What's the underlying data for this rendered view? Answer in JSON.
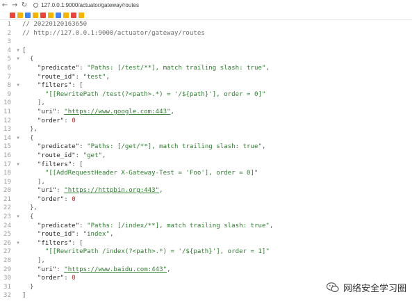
{
  "browser": {
    "url": "127.0.0.1:9000/actuator/gateway/routes",
    "back_icon": "back-arrow-icon",
    "forward_icon": "forward-arrow-icon",
    "reload_icon": "reload-icon"
  },
  "bookmarks": [
    {
      "icon": "bookmark-icon-1",
      "color": "#e8453c"
    },
    {
      "icon": "bookmark-icon-2",
      "color": "#f4b400"
    },
    {
      "icon": "bookmark-icon-3",
      "color": "#4285f4"
    },
    {
      "icon": "bookmark-icon-4",
      "color": "#f4b400"
    },
    {
      "icon": "bookmark-icon-5",
      "color": "#e8453c"
    },
    {
      "icon": "bookmark-icon-6",
      "color": "#f4b400"
    },
    {
      "icon": "bookmark-icon-7",
      "color": "#4285f4"
    },
    {
      "icon": "bookmark-icon-8",
      "color": "#f4b400"
    },
    {
      "icon": "bookmark-icon-9",
      "color": "#e8453c"
    },
    {
      "icon": "bookmark-icon-10",
      "color": "#f4b400"
    }
  ],
  "code": {
    "line_numbers": [
      "1",
      "2",
      "3",
      "4",
      "5",
      "6",
      "7",
      "8",
      "9",
      "10",
      "11",
      "12",
      "13",
      "14",
      "15",
      "16",
      "17",
      "18",
      "19",
      "20",
      "21",
      "22",
      "23",
      "24",
      "25",
      "26",
      "27",
      "28",
      "29",
      "30",
      "31",
      "32"
    ],
    "comment_1": "// 20220120163650",
    "comment_2": "// http://127.0.0.1:9000/actuator/gateway/routes",
    "routes": [
      {
        "predicate_key": "\"predicate\"",
        "predicate": "\"Paths: [/test/**], match trailing slash: true\"",
        "route_id_key": "\"route_id\"",
        "route_id": "\"test\"",
        "filters_key": "\"filters\"",
        "filter": "\"[[RewritePath /test(?<path>.*) = '/${path}'], order = 0]\"",
        "uri_key": "\"uri\"",
        "uri": "\"https://www.google.com:443\"",
        "order_key": "\"order\"",
        "order": "0"
      },
      {
        "predicate_key": "\"predicate\"",
        "predicate": "\"Paths: [/get/**], match trailing slash: true\"",
        "route_id_key": "\"route_id\"",
        "route_id": "\"get\"",
        "filters_key": "\"filters\"",
        "filter": "\"[[AddRequestHeader X-Gateway-Test = 'Foo'], order = 0]\"",
        "uri_key": "\"uri\"",
        "uri": "\"https://httpbin.org:443\"",
        "order_key": "\"order\"",
        "order": "0"
      },
      {
        "predicate_key": "\"predicate\"",
        "predicate": "\"Paths: [/index/**], match trailing slash: true\"",
        "route_id_key": "\"route_id\"",
        "route_id": "\"index\"",
        "filters_key": "\"filters\"",
        "filter": "\"[[RewritePath /index(?<path>.*) = '/${path}'], order = 1]\"",
        "uri_key": "\"uri\"",
        "uri": "\"https://www.baidu.com:443\"",
        "order_key": "\"order\"",
        "order": "0"
      }
    ]
  },
  "watermark": {
    "text": "网络安全学习圈",
    "icon": "wechat-logo-icon"
  }
}
